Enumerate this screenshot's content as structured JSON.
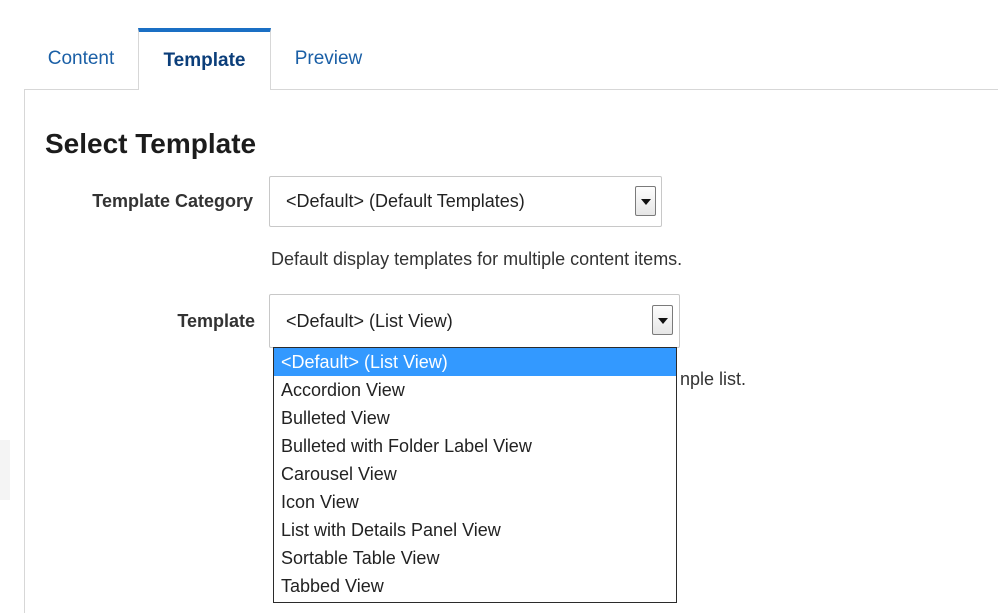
{
  "tabs": [
    {
      "label": "Content",
      "active": false
    },
    {
      "label": "Template",
      "active": true
    },
    {
      "label": "Preview",
      "active": false
    }
  ],
  "heading": "Select Template",
  "template_category": {
    "label": "Template Category",
    "value": "<Default> (Default Templates)",
    "description": "Default display templates for multiple content items."
  },
  "template": {
    "label": "Template",
    "value": "<Default> (List View)",
    "description_visible_tail": "nple list.",
    "options": [
      {
        "label": "<Default> (List View)",
        "selected": true
      },
      {
        "label": "Accordion View",
        "selected": false
      },
      {
        "label": "Bulleted View",
        "selected": false
      },
      {
        "label": "Bulleted with Folder Label View",
        "selected": false
      },
      {
        "label": "Carousel View",
        "selected": false
      },
      {
        "label": "Icon View",
        "selected": false
      },
      {
        "label": "List with Details Panel View",
        "selected": false
      },
      {
        "label": "Sortable Table View",
        "selected": false
      },
      {
        "label": "Tabbed View",
        "selected": false
      }
    ]
  },
  "colors": {
    "tab_link": "#1a5fa6",
    "tab_active_text": "#0b3e7a",
    "tab_active_bar": "#1a6fc4",
    "option_highlight": "#3399ff"
  },
  "icons": {
    "select_arrow": "chevron-down-icon"
  }
}
